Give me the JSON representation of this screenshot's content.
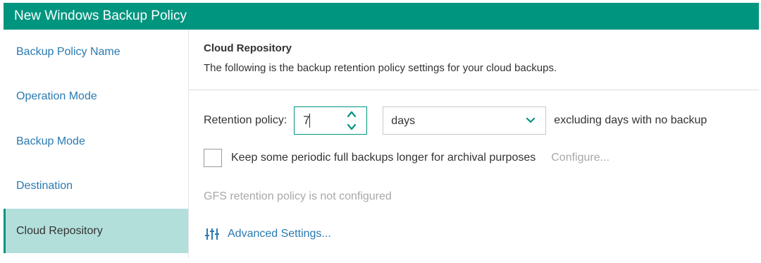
{
  "window": {
    "title": "New Windows Backup Policy"
  },
  "sidebar": {
    "items": [
      {
        "label": "Backup Policy Name"
      },
      {
        "label": "Operation Mode"
      },
      {
        "label": "Backup Mode"
      },
      {
        "label": "Destination"
      },
      {
        "label": "Cloud Repository",
        "active": true
      }
    ]
  },
  "main": {
    "title": "Cloud Repository",
    "description": "The following is the backup retention policy settings for your cloud backups.",
    "retention": {
      "label": "Retention policy:",
      "value": "7",
      "unit": "days",
      "suffix": "excluding days with no backup"
    },
    "archival": {
      "label": "Keep some periodic full backups longer for archival purposes",
      "checked": false,
      "configure_label": "Configure..."
    },
    "gfs_status": "GFS retention policy is not configured",
    "advanced_label": "Advanced Settings..."
  },
  "colors": {
    "accent": "#00957f",
    "active_bg": "#b3dfdb",
    "link": "#2a7ab0",
    "disabled": "#a8a8a8"
  }
}
